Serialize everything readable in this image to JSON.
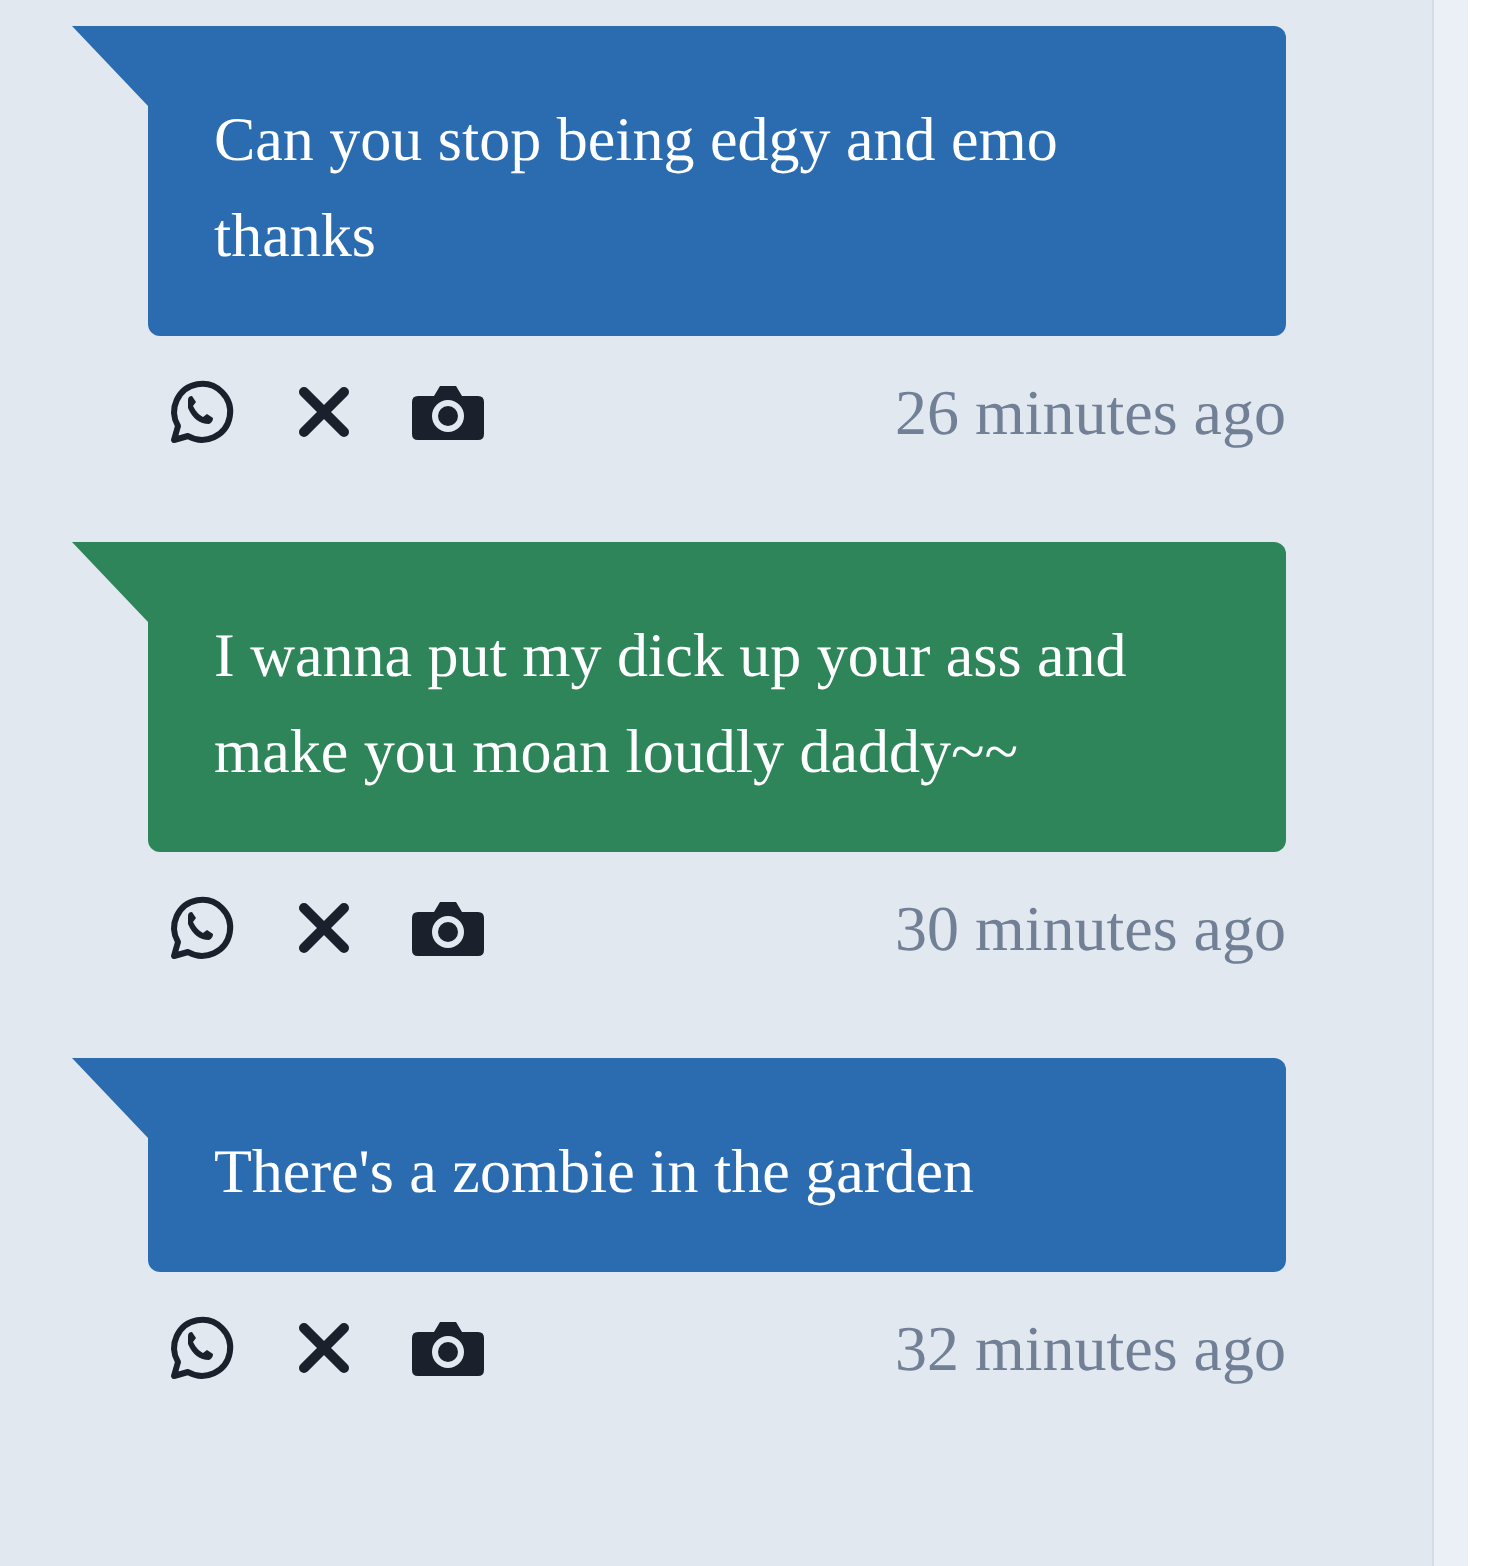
{
  "messages": [
    {
      "text": "Can you stop being edgy and emo thanks",
      "color": "#2b6cb0",
      "time": "26 minutes ago"
    },
    {
      "text": "I wanna put my dick up your ass and make you moan loudly daddy~~",
      "color": "#2f855a",
      "time": "30 minutes ago"
    },
    {
      "text": "There's a zombie in the garden",
      "color": "#2b6cb0",
      "time": "32 minutes ago"
    }
  ]
}
